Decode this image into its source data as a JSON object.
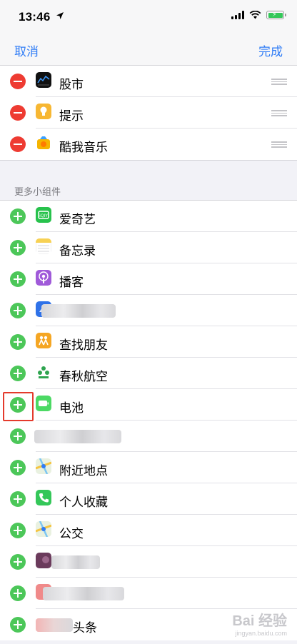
{
  "status_bar": {
    "time": "13:46"
  },
  "nav": {
    "cancel_label": "取消",
    "done_label": "完成"
  },
  "included_widgets": [
    {
      "label": "股市",
      "icon": "stocks-icon"
    },
    {
      "label": "提示",
      "icon": "tips-icon"
    },
    {
      "label": "酷我音乐",
      "icon": "kuwo-music-icon"
    }
  ],
  "more_header": "更多小组件",
  "more_widgets": [
    {
      "label": "爱奇艺",
      "icon": "iqiyi-icon"
    },
    {
      "label": "备忘录",
      "icon": "notes-icon"
    },
    {
      "label": "播客",
      "icon": "podcasts-icon"
    },
    {
      "label": "",
      "icon": "blurred-app-icon",
      "obscured": true
    },
    {
      "label": "查找朋友",
      "icon": "find-friends-icon"
    },
    {
      "label": "春秋航空",
      "icon": "spring-airlines-icon"
    },
    {
      "label": "电池",
      "icon": "battery-widget-icon"
    },
    {
      "label": "",
      "icon": "blurred-app-icon",
      "obscured": true
    },
    {
      "label": "附近地点",
      "icon": "maps-nearby-icon"
    },
    {
      "label": "个人收藏",
      "icon": "phone-favorites-icon"
    },
    {
      "label": "公交",
      "icon": "maps-transit-icon"
    },
    {
      "label": "",
      "icon": "blurred-app-icon",
      "obscured": true
    },
    {
      "label": "",
      "icon": "blurred-app-icon",
      "obscured": true
    },
    {
      "label": "头条",
      "icon": "news-icon",
      "partially_obscured": true
    }
  ],
  "watermark": {
    "main": "Bai 经验",
    "sub": "jingyan.baidu.com"
  },
  "colors": {
    "accent": "#2f7cf6",
    "add": "#4cc759",
    "remove": "#ee3b32",
    "highlight": "#e43a2c"
  }
}
